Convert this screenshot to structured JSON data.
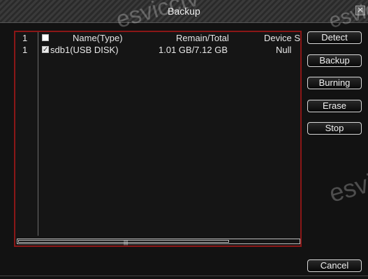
{
  "window": {
    "title": "Backup",
    "close_glyph": "✕",
    "watermark": "esvicctv"
  },
  "table": {
    "headers": {
      "index": "1",
      "name": "Name(Type)",
      "remain_total": "Remain/Total",
      "device_status": "Device S"
    },
    "rows": [
      {
        "index": "1",
        "checked": true,
        "name": "sdb1(USB DISK)",
        "remain_total": "1.01 GB/7.12 GB",
        "device_status": "Null"
      }
    ]
  },
  "buttons": {
    "detect": "Detect",
    "backup": "Backup",
    "burning": "Burning",
    "erase": "Erase",
    "stop": "Stop",
    "cancel": "Cancel"
  },
  "scroll": {
    "grip": "|||"
  },
  "icons": {
    "close": "close-icon",
    "checkbox": "checkbox-icon",
    "checkbox_checked": "checkbox-checked-icon"
  },
  "colors": {
    "background": "#121212",
    "frame_border": "#8a1717"
  }
}
